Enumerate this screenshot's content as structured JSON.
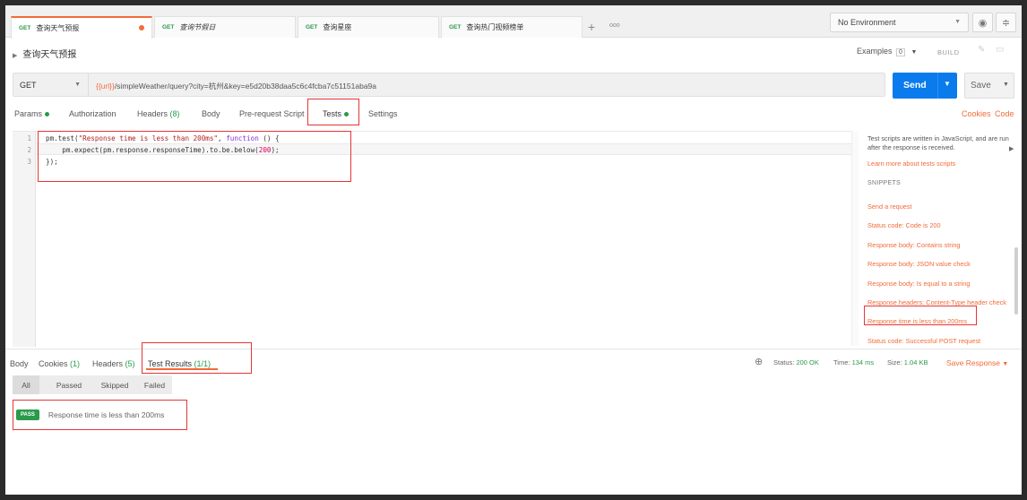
{
  "tabs": [
    {
      "method": "GET",
      "title": "查询天气预报",
      "italic": false,
      "modified": true
    },
    {
      "method": "GET",
      "title": "查询节假日",
      "italic": true,
      "modified": false
    },
    {
      "method": "GET",
      "title": "查询星座",
      "italic": false,
      "modified": false
    },
    {
      "method": "GET",
      "title": "查询热门视频榜单",
      "italic": false,
      "modified": false
    }
  ],
  "new_tab_label": "+",
  "more_tabs_label": "ooo",
  "environment": {
    "selected": "No Environment"
  },
  "request": {
    "name": "查询天气预报",
    "examples_label": "Examples",
    "examples_count": "0",
    "build_label": "BUILD",
    "method": "GET",
    "url_var": "{{url}}",
    "url_rest": "/simpleWeather/query?city=杭州&key=e5d20b38daa5c6c4fcba7c51151aba9a",
    "send_label": "Send",
    "save_label": "Save"
  },
  "request_tabs": {
    "params": "Params",
    "authorization": "Authorization",
    "headers": "Headers",
    "headers_count": "(8)",
    "body": "Body",
    "prerequest": "Pre-request Script",
    "tests": "Tests",
    "settings": "Settings",
    "cookies": "Cookies",
    "code": "Code"
  },
  "editor": {
    "line_numbers": [
      "1",
      "2",
      "3"
    ],
    "line1": {
      "obj": "pm.test(",
      "str": "\"Response time is less than 200ms\"",
      "mid": ", ",
      "kw": "function",
      "end": " () {"
    },
    "line2": {
      "pre": "    pm.expect(pm.response.responseTime).to.be.below(",
      "num": "200",
      "end": ");"
    },
    "line3": "});"
  },
  "snippets_panel": {
    "description": "Test scripts are written in JavaScript, and are run after the response is received.",
    "learn_more": "Learn more about tests scripts",
    "title": "SNIPPETS",
    "items": [
      "Send a request",
      "Status code: Code is 200",
      "Response body: Contains string",
      "Response body: JSON value check",
      "Response body: Is equal to a string",
      "Response headers: Content-Type header check",
      "Response time is less than 200ms",
      "Status code: Successful POST request"
    ]
  },
  "response_tabs": {
    "body": "Body",
    "cookies": "Cookies",
    "cookies_count": "(1)",
    "headers": "Headers",
    "headers_count": "(5)",
    "test_results": "Test Results",
    "test_results_count": "(1/1)"
  },
  "response_status": {
    "status_label": "Status:",
    "status_value": "200 OK",
    "time_label": "Time:",
    "time_value": "134 ms",
    "size_label": "Size:",
    "size_value": "1.04 KB",
    "save_response": "Save Response"
  },
  "filters": [
    "All",
    "Passed",
    "Skipped",
    "Failed"
  ],
  "results": [
    {
      "badge": "PASS",
      "name": "Response time is less than 200ms"
    }
  ],
  "colors": {
    "accent": "#f26b3a",
    "send": "#097bed",
    "pass": "#2a9a4b",
    "highlight_box": "#e53535"
  }
}
